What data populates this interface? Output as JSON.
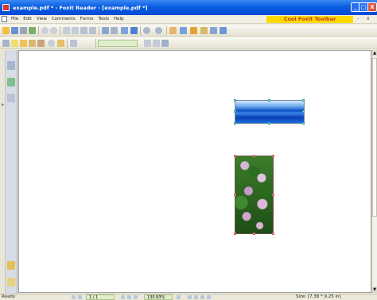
{
  "window": {
    "title": "example.pdf * - Foxit Reader - [example.pdf *]",
    "minimize_label": "_",
    "maximize_label": "□",
    "close_label": "X"
  },
  "menubar": {
    "items": [
      "File",
      "Edit",
      "View",
      "Comments",
      "Forms",
      "Tools",
      "Help"
    ],
    "banner": "Cool Foxit Toolbar",
    "doc_minimize": "-",
    "doc_close": "x"
  },
  "toolbar": {
    "zoom_arrow": "▾"
  },
  "sidebar": {
    "pin_label": "»"
  },
  "scrollbar": {
    "up": "▲",
    "down": "▼"
  },
  "statusbar": {
    "status": "Ready",
    "page": "1 / 1",
    "zoom": "130.93%",
    "page_size": "Size: [7.38 * 9.25 in]"
  },
  "colors": {
    "titlebar": "#0a5ee0",
    "banner_bg": "#ffd800",
    "banner_text": "#c0392b"
  }
}
